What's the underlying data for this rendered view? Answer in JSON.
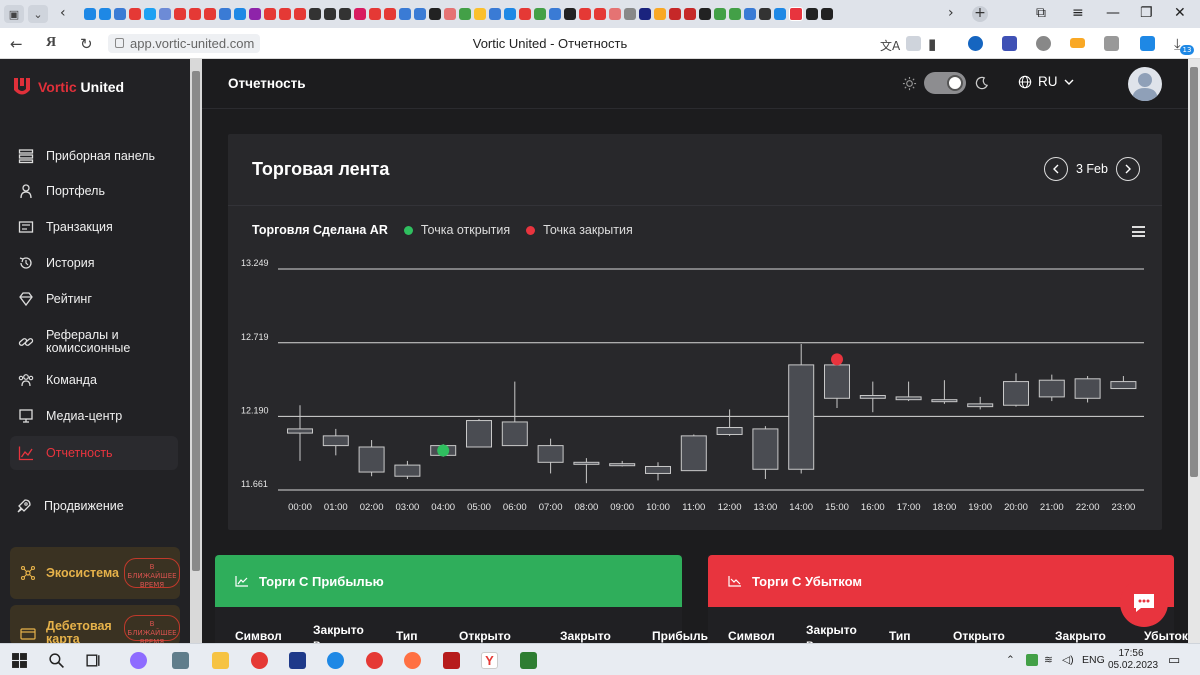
{
  "browser": {
    "url": "app.vortic-united.com",
    "page_title": "Vortic United - Отчетность",
    "download_count": "13"
  },
  "sidebar": {
    "logo_red": "Vortic",
    "logo_white": "United",
    "items": [
      {
        "label": "Приборная панель",
        "icon": "dashboard-icon"
      },
      {
        "label": "Портфель",
        "icon": "user-icon"
      },
      {
        "label": "Транзакция",
        "icon": "transaction-icon"
      },
      {
        "label": "История",
        "icon": "history-icon"
      },
      {
        "label": "Рейтинг",
        "icon": "diamond-icon"
      },
      {
        "label": "Рефералы и комиссионные",
        "icon": "link-icon"
      },
      {
        "label": "Команда",
        "icon": "team-icon"
      },
      {
        "label": "Медиа-центр",
        "icon": "media-icon"
      },
      {
        "label": "Отчетность",
        "icon": "chart-icon",
        "active": true
      }
    ],
    "promote_label": "Продвижение",
    "promos": [
      {
        "label": "Экосистема",
        "badge": "В БЛИЖАЙШЕЕ ВРЕМЯ"
      },
      {
        "label": "Дебетовая карта",
        "badge": "В БЛИЖАЙШЕЕ ВРЕМЯ"
      }
    ]
  },
  "topbar": {
    "title": "Отчетность",
    "language": "RU"
  },
  "feed": {
    "title": "Торговая лента",
    "date": "3 Feb"
  },
  "chart_data": {
    "type": "candlestick",
    "title": "Торговля Сделана AR",
    "legend": [
      {
        "name": "Точка открытия",
        "color": "#2fbf5f"
      },
      {
        "name": "Точка закрытия",
        "color": "#e8343e"
      }
    ],
    "y_ticks": [
      11.661,
      12.19,
      12.719,
      13.249
    ],
    "ylim": [
      11.661,
      13.249
    ],
    "categories": [
      "00:00",
      "01:00",
      "02:00",
      "03:00",
      "04:00",
      "05:00",
      "06:00",
      "07:00",
      "08:00",
      "09:00",
      "10:00",
      "11:00",
      "12:00",
      "13:00",
      "14:00",
      "15:00",
      "16:00",
      "17:00",
      "18:00",
      "19:00",
      "20:00",
      "21:00",
      "22:00",
      "23:00"
    ],
    "ohlc": [
      [
        12.1,
        12.27,
        11.87,
        12.07
      ],
      [
        12.05,
        12.1,
        11.91,
        11.98
      ],
      [
        11.97,
        12.02,
        11.76,
        11.79
      ],
      [
        11.84,
        11.87,
        11.74,
        11.76
      ],
      [
        11.98,
        11.99,
        11.9,
        11.91
      ],
      [
        12.16,
        12.17,
        11.98,
        11.97
      ],
      [
        12.15,
        12.44,
        11.98,
        11.98
      ],
      [
        11.98,
        12.03,
        11.78,
        11.86
      ],
      [
        11.86,
        11.89,
        11.71,
        11.85
      ],
      [
        11.85,
        11.87,
        11.83,
        11.84
      ],
      [
        11.83,
        11.86,
        11.73,
        11.78
      ],
      [
        12.05,
        12.06,
        11.8,
        11.8
      ],
      [
        12.11,
        12.24,
        12.05,
        12.06
      ],
      [
        12.1,
        12.12,
        11.74,
        11.81
      ],
      [
        12.56,
        12.71,
        11.78,
        11.81
      ],
      [
        12.56,
        12.58,
        12.25,
        12.32
      ],
      [
        12.34,
        12.44,
        12.22,
        12.32
      ],
      [
        12.33,
        12.44,
        12.3,
        12.31
      ],
      [
        12.31,
        12.45,
        12.28,
        12.3
      ],
      [
        12.28,
        12.33,
        12.24,
        12.26
      ],
      [
        12.44,
        12.5,
        12.26,
        12.27
      ],
      [
        12.45,
        12.49,
        12.3,
        12.33
      ],
      [
        12.46,
        12.48,
        12.29,
        12.32
      ],
      [
        12.44,
        12.48,
        12.39,
        12.39
      ]
    ],
    "markers": [
      {
        "series": "Точка открытия",
        "x": "04:00",
        "y": 11.945,
        "color": "#2fbf5f"
      },
      {
        "series": "Точка закрытия",
        "x": "15:00",
        "y": 12.6,
        "color": "#e8343e"
      }
    ]
  },
  "profit_table": {
    "title": "Торги С Прибылью",
    "columns": [
      "Символ",
      "Закрыто в",
      "Тип",
      "Открыто",
      "Закрыто",
      "Прибыль"
    ],
    "color": "#2fae5b"
  },
  "loss_table": {
    "title": "Торги С Убытком",
    "columns": [
      "Символ",
      "Закрыто в",
      "Тип",
      "Открыто",
      "Закрыто",
      "Убыток"
    ],
    "color": "#e8343e"
  },
  "taskbar": {
    "language": "ENG",
    "time": "17:56",
    "date": "05.02.2023"
  }
}
